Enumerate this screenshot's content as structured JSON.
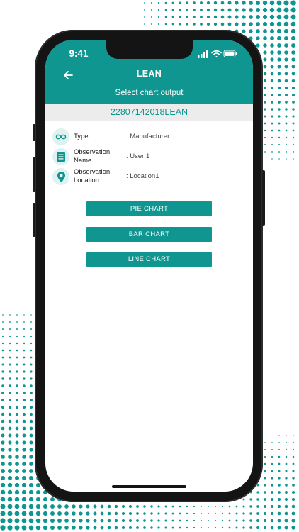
{
  "status_bar": {
    "time": "9:41",
    "icons": [
      "cellular-signal-icon",
      "wifi-icon",
      "battery-icon"
    ]
  },
  "header": {
    "back_icon": "arrow-left-icon",
    "title": "LEAN",
    "subtitle": "Select chart output"
  },
  "record": {
    "code": "22807142018LEAN"
  },
  "details": [
    {
      "icon": "infinity-icon",
      "label": "Type",
      "value": ": Manufacturer"
    },
    {
      "icon": "document-icon",
      "label": "Observation Name",
      "value": ": User 1"
    },
    {
      "icon": "location-pin-icon",
      "label": "Observation Location",
      "value": ": Location1"
    }
  ],
  "actions": {
    "pie_chart": "PIE CHART",
    "bar_chart": "BAR CHART",
    "line_chart": "LINE CHART"
  },
  "colors": {
    "accent": "#0f9691",
    "band": "#ececec",
    "icon_bg": "#dff1f0",
    "frame": "#141414"
  }
}
